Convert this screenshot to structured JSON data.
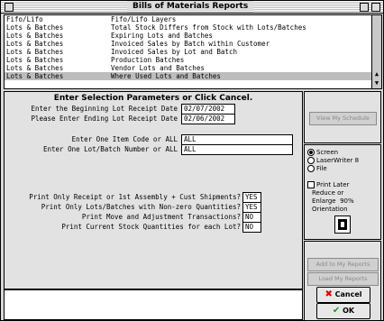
{
  "window": {
    "title": "Bills of Materials Reports"
  },
  "reports": [
    {
      "category": "Fifo/Lifo",
      "name": "Fifo/Lifo Layers"
    },
    {
      "category": "Lots & Batches",
      "name": "Total Stock Differs from Stock with Lots/Batches"
    },
    {
      "category": "Lots & Batches",
      "name": "Expiring Lots and Batches"
    },
    {
      "category": "Lots & Batches",
      "name": "Invoiced Sales by Batch within Customer"
    },
    {
      "category": "Lots & Batches",
      "name": "Invoiced Sales by Lot and Batch"
    },
    {
      "category": "Lots & Batches",
      "name": "Production Batches"
    },
    {
      "category": "Lots & Batches",
      "name": "Vendor Lots and Batches"
    },
    {
      "category": "Lots & Batches",
      "name": "Where Used Lots and Batches"
    }
  ],
  "params": {
    "heading": "Enter Selection Parameters or Click Cancel.",
    "begin_label": "Enter the Beginning Lot Receipt Date",
    "begin_value": "02/07/2002",
    "end_label": "Please Enter Ending Lot Receipt Date",
    "end_value": "02/06/2002",
    "item_label": "Enter One Item Code or ALL",
    "item_value": "ALL",
    "lot_label": "Enter One Lot/Batch Number or ALL",
    "lot_value": "ALL",
    "q1_label": "Print Only Receipt or 1st Assembly + Cust Shipments?",
    "q1_value": "YES",
    "q2_label": "Print Only Lots/Batches with Non-zero Quantities?",
    "q2_value": "YES",
    "q3_label": "Print Move and Adjustment Transactions?",
    "q3_value": "NO",
    "q4_label": "Print Current Stock Quantities for each Lot?",
    "q4_value": "NO"
  },
  "side": {
    "view_schedule": "View My Schedule",
    "dest_screen": "Screen",
    "dest_printer": "LaserWriter 8",
    "dest_file": "File",
    "print_later": "Print Later",
    "reduce_label": "Reduce or",
    "enlarge_label": "Enlarge",
    "enlarge_value": "90%",
    "orientation_label": "Orientation",
    "add_reports": "Add to My Reports",
    "load_reports": "Load My Reports",
    "cancel": "Cancel",
    "ok": "OK"
  }
}
